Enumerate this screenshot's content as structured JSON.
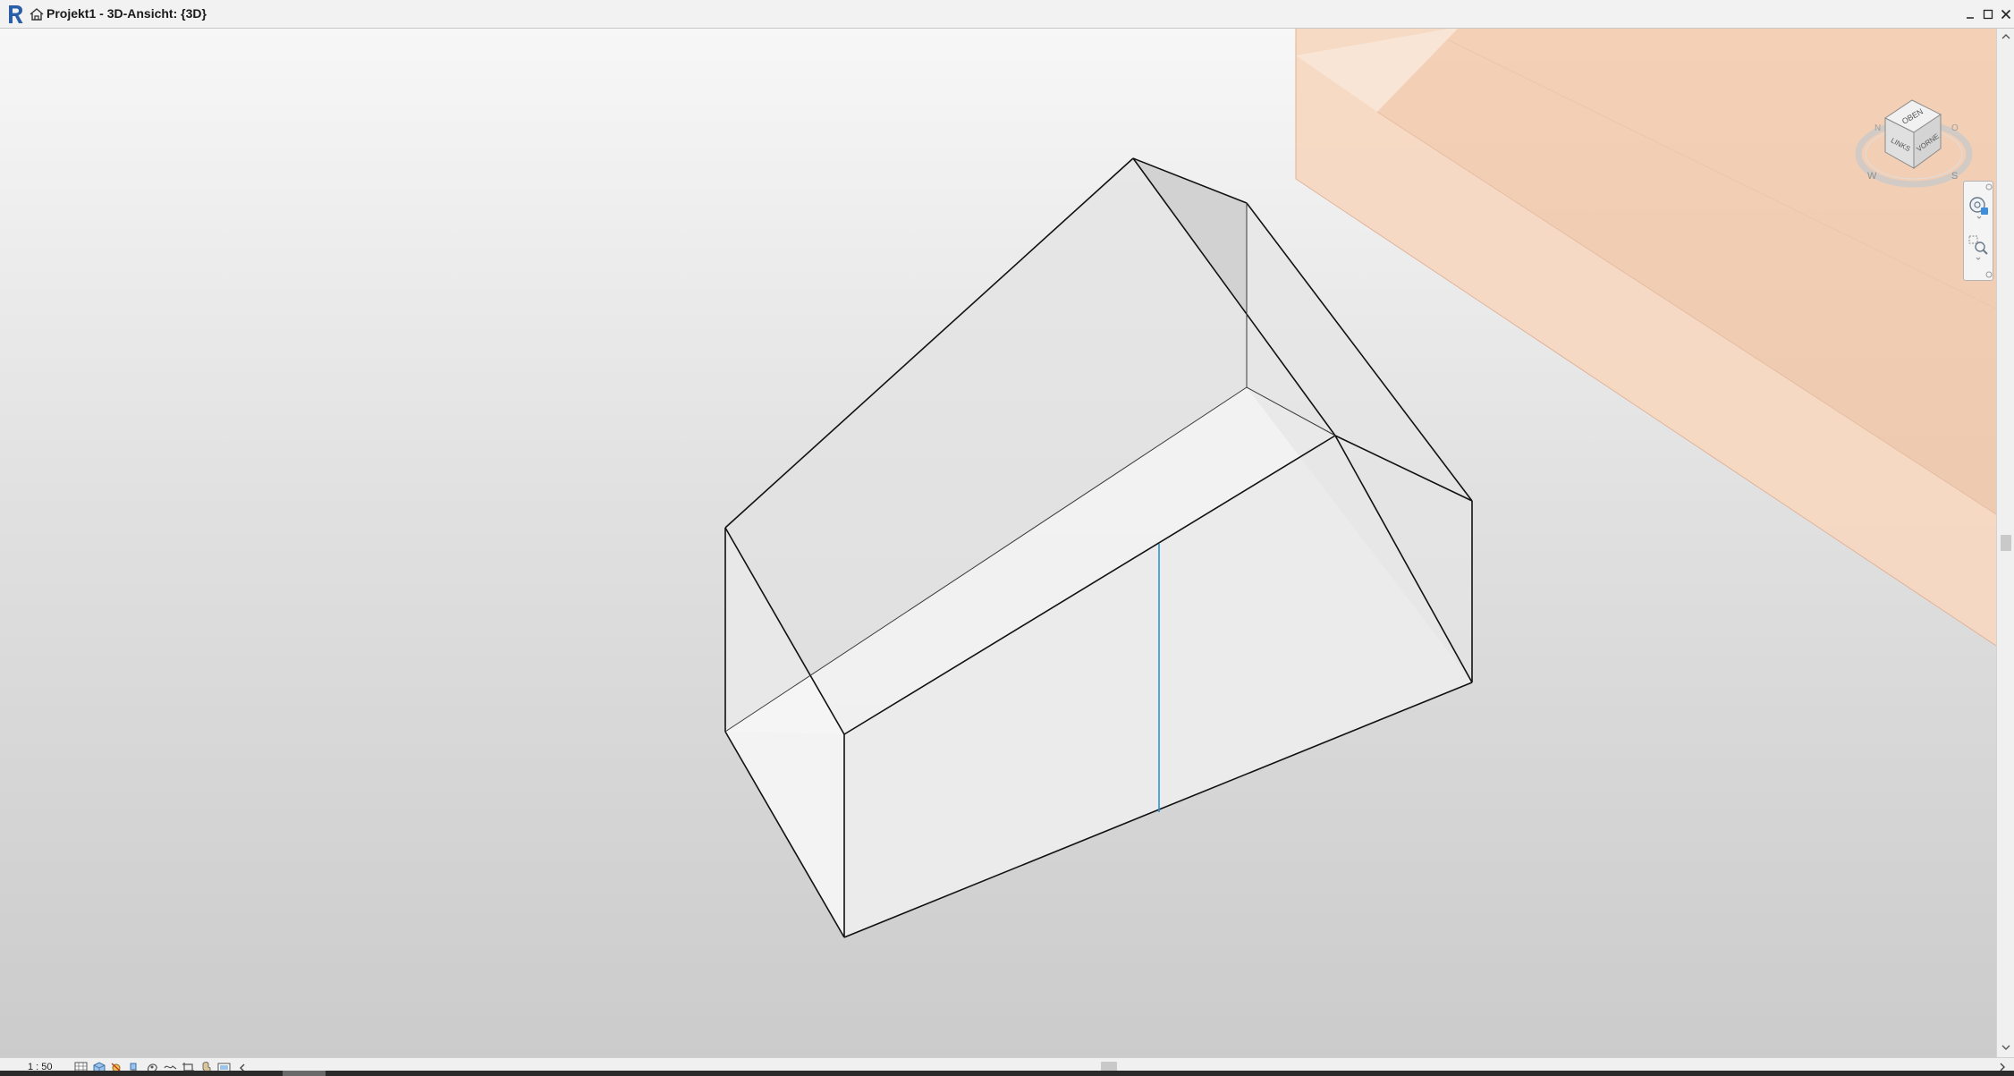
{
  "window": {
    "title": "Projekt1 - 3D-Ansicht: {3D}",
    "app_icon": "revit-logo-icon",
    "view_icon": "3d-house-view-icon",
    "controls": [
      "minimize-icon",
      "maximize-icon",
      "close-icon"
    ]
  },
  "viewcube": {
    "faces": {
      "top": "OBEN",
      "left": "LINKS",
      "front": "VORNE"
    },
    "compass": {
      "north": "N",
      "east": "O",
      "south": "S",
      "west": "W"
    }
  },
  "navigation_bar": {
    "tools": [
      "steering-wheel-icon",
      "zoom-region-icon"
    ]
  },
  "status_bar": {
    "scale": "1 : 50",
    "view_controls": [
      "detail-level-icon",
      "visual-style-icon",
      "sun-path-icon",
      "shadows-icon",
      "render-icon",
      "crop-view-icon",
      "show-crop-region-icon",
      "temporary-hide-icon",
      "reveal-hidden-icon"
    ],
    "scroll_arrow": "chevron-left-icon"
  },
  "colors": {
    "ground_plane": "#f2bb92",
    "model_edge": "#111111",
    "selected_edge": "#2d8fd6",
    "title_bar": "#f2f2f2",
    "viewport_top": "#f7f7f7",
    "viewport_bottom": "#cbcbcb"
  }
}
